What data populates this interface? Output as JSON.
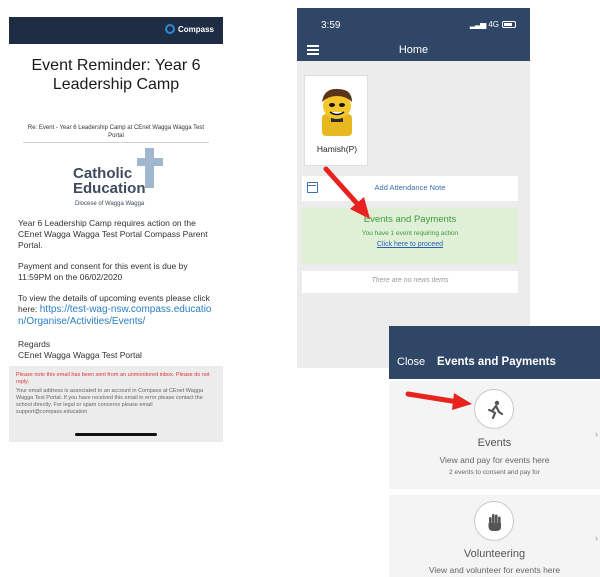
{
  "email": {
    "brand": "Compass",
    "title": "Event Reminder: Year 6 Leadership Camp",
    "re_line": "Re: Event - Year 6 Leadership Camp at CEnet Wagga Wagga Test Portal",
    "logo_name": "Catholic Education",
    "logo_diocese": "Diocese of Wagga Wagga",
    "para1": "Year 6 Leadership Camp requires action on the CEnet Wagga Wagga Test Portal Compass Parent Portal.",
    "para2": "Payment and consent for this event is due by 11:59PM on the 06/02/2020",
    "para3": "To view the details of upcoming events please click here:",
    "para3_link": "https://test-wag-nsw.compass.education/Organise/Activities/Events/",
    "regards": "Regards",
    "signature": "CEnet Wagga Wagga Test Portal",
    "footer_warn": "Please note this email has been sent from an unmonitored inbox. Please do not reply.",
    "footer_info": "Your email address is associated to an account in Compass at CEnet Wagga Wagga Test Portal. If you have received this email in error please contact the school directly. For legal or spam concerns please email support@compass.education"
  },
  "phone": {
    "status_time": "3:59",
    "status_network": "4G",
    "title": "Home",
    "student_name": "Hamish(P)",
    "attendance_label": "Add Attendance Note",
    "events_title": "Events and Payments",
    "events_sub": "You have 1 event requiring action",
    "events_link": "Click here to proceed",
    "news_label": "There are no news items"
  },
  "events_panel": {
    "close_label": "Close",
    "title": "Events and Payments",
    "rows": [
      {
        "title": "Events",
        "desc": "View and pay for events here",
        "sub": "2 events to consent and pay for"
      },
      {
        "title": "Volunteering",
        "desc": "View and volunteer for events here"
      }
    ]
  },
  "colors": {
    "header_navy": "#304666",
    "email_header": "#1e2d44",
    "link_blue": "#2a7dc4",
    "success_green": "#3f9a3f",
    "success_bg": "#dff0d6",
    "arrow_red": "#e8231f"
  }
}
